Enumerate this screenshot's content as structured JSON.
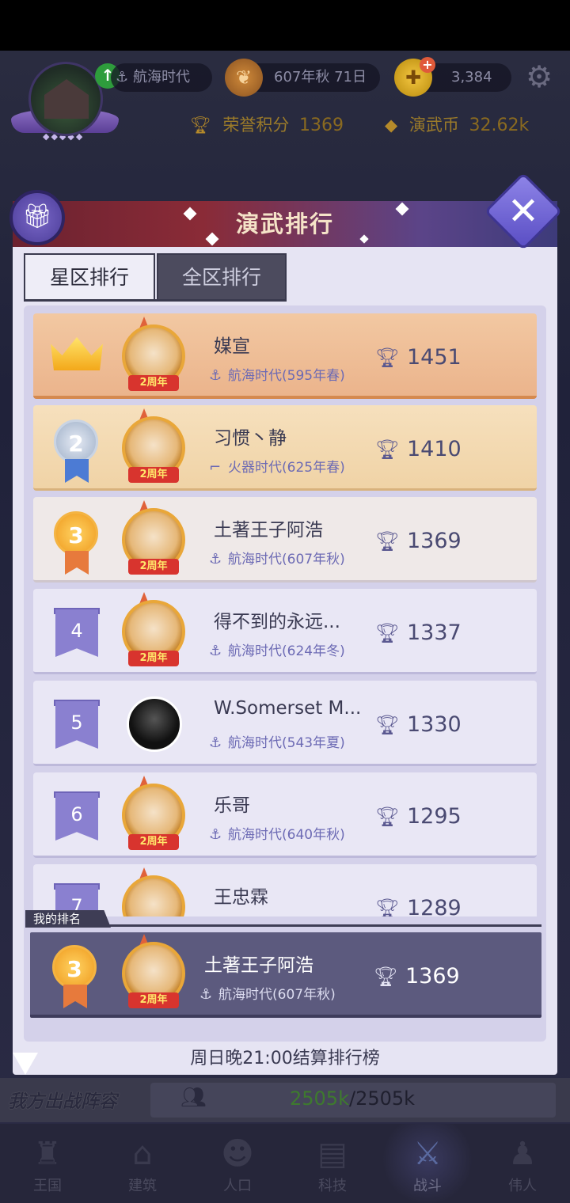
{
  "hud": {
    "era": "航海时代",
    "date": "607年秋 71日",
    "gold": "3,384",
    "honor_label": "荣誉积分",
    "honor_value": "1369",
    "coin_label": "演武币",
    "coin_value": "32.62k"
  },
  "modal": {
    "title": "演武排行",
    "tabs": [
      "星区排行",
      "全区排行"
    ],
    "active_tab": "星区排行",
    "my_rank_label": "我的排名",
    "footer_note": "周日晚21:00结算排行榜"
  },
  "rankings": [
    {
      "rank": "1",
      "name": "媒宣",
      "era": "航海时代(595年春)",
      "score": "1451",
      "era_icon": "anchor-icon"
    },
    {
      "rank": "2",
      "name": "习惯丶静",
      "era": "火器时代(625年春)",
      "score": "1410",
      "era_icon": "gun-icon"
    },
    {
      "rank": "3",
      "name": "土著王子阿浩",
      "era": "航海时代(607年秋)",
      "score": "1369",
      "era_icon": "anchor-icon"
    },
    {
      "rank": "4",
      "name": "得不到的永远...",
      "era": "航海时代(624年冬)",
      "score": "1337",
      "era_icon": "anchor-icon"
    },
    {
      "rank": "5",
      "name": "W.Somerset M...",
      "era": "航海时代(543年夏)",
      "score": "1330",
      "era_icon": "anchor-icon"
    },
    {
      "rank": "6",
      "name": "乐哥",
      "era": "航海时代(640年秋)",
      "score": "1295",
      "era_icon": "anchor-icon"
    },
    {
      "rank": "7",
      "name": "王忠霖",
      "era": "",
      "score": "1289",
      "era_icon": "anchor-icon"
    }
  ],
  "anniversary_tag": "2周年",
  "my_rank": {
    "rank": "3",
    "name": "土著王子阿浩",
    "era": "航海时代(607年秋)",
    "score": "1369"
  },
  "power": {
    "label": "我方出战阵容",
    "current": "2505k",
    "separator": "/",
    "max": "2505k"
  },
  "nav": [
    {
      "label": "王国",
      "icon": "castle-icon"
    },
    {
      "label": "建筑",
      "icon": "house-icon"
    },
    {
      "label": "人口",
      "icon": "person-icon"
    },
    {
      "label": "科技",
      "icon": "book-icon"
    },
    {
      "label": "战斗",
      "icon": "swords-icon",
      "active": true
    },
    {
      "label": "伟人",
      "icon": "statue-icon"
    }
  ],
  "colors": {
    "accent": "#5c5a7e",
    "first_row": "#f2c8a2",
    "second_row": "#f6e0bd",
    "score_text": "#4a4a72",
    "power_current": "#3e7a2e"
  }
}
